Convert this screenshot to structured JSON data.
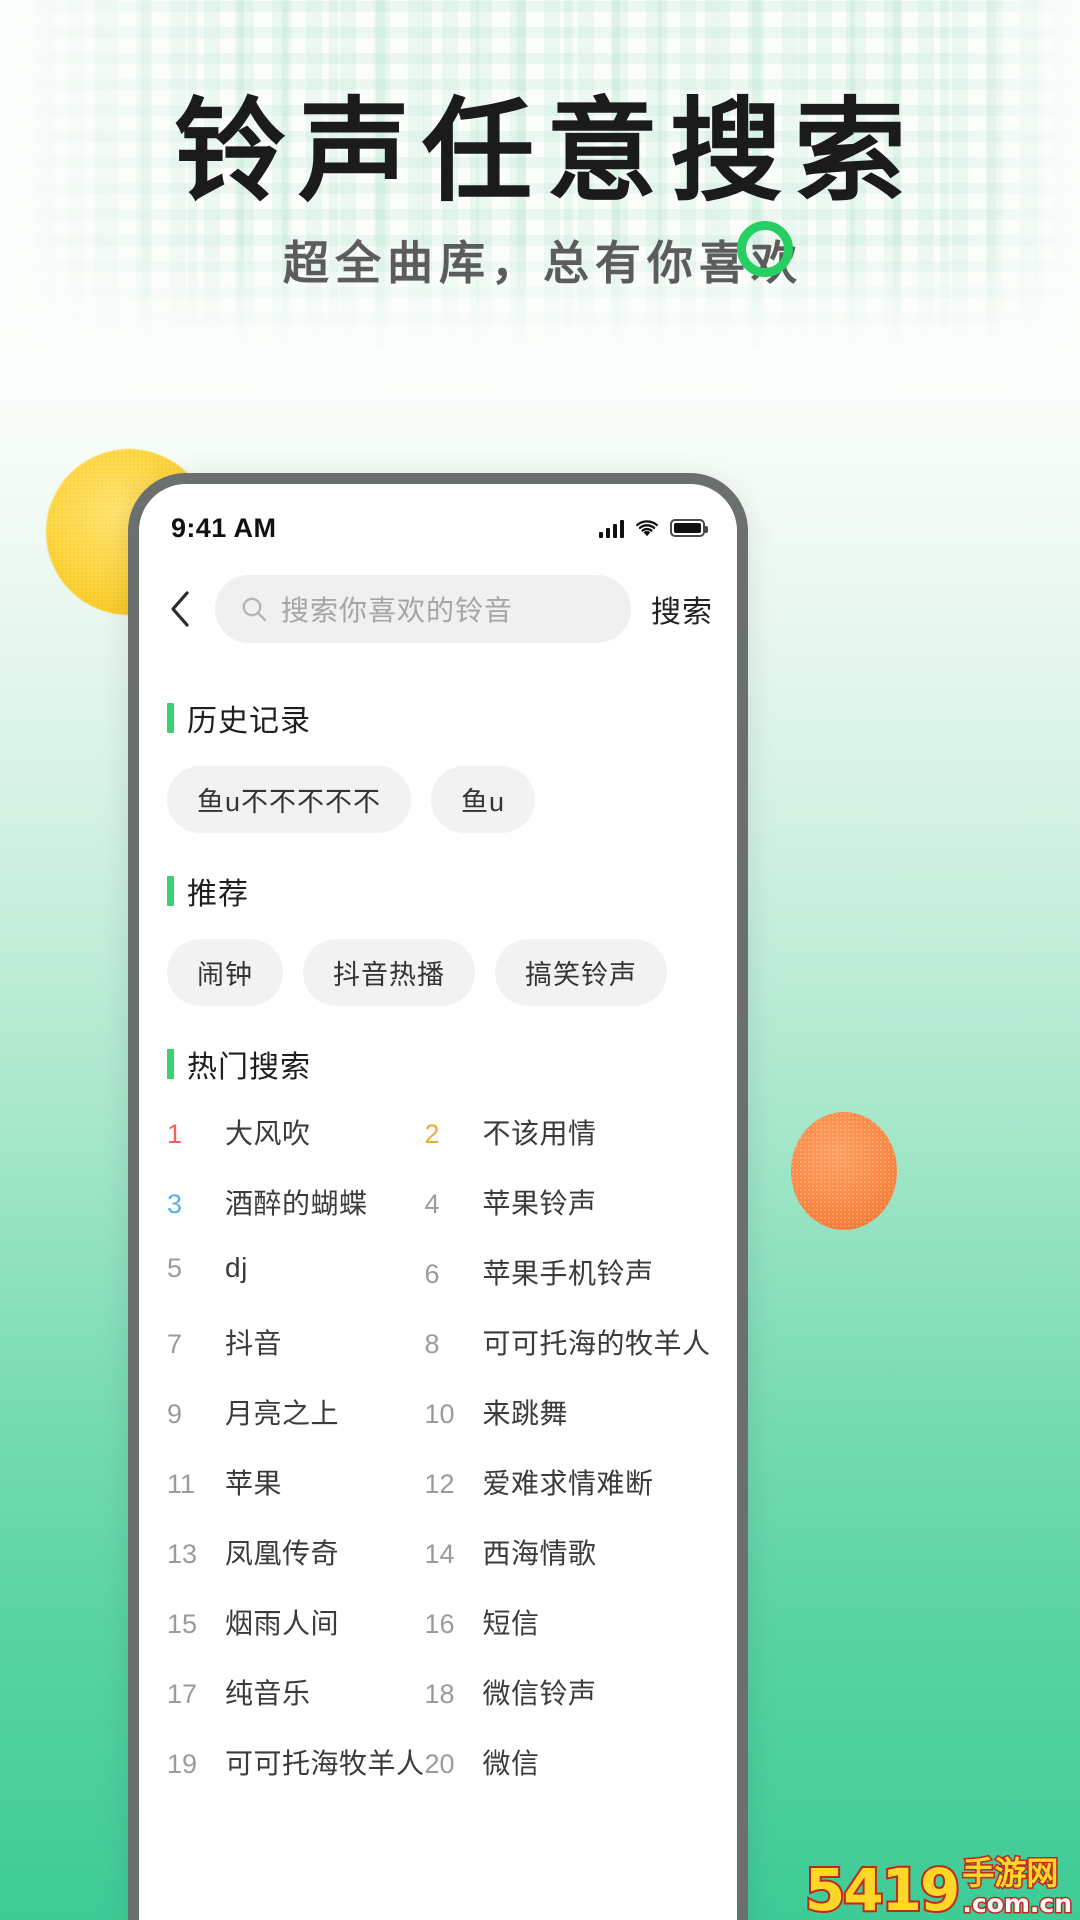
{
  "hero": {
    "title": "铃声任意搜索",
    "subtitle": "超全曲库，总有你喜欢",
    "ring_color": "#25cf62"
  },
  "phone": {
    "status_bar": {
      "time": "9:41 AM",
      "signal_icon": "signal-bars-icon",
      "wifi_icon": "wifi-icon",
      "battery_icon": "battery-full-icon"
    },
    "search": {
      "back_icon": "chevron-left-icon",
      "search_icon": "search-icon",
      "placeholder": "搜索你喜欢的铃音",
      "value": "",
      "action_label": "搜索"
    },
    "sections": [
      {
        "title": "历史记录",
        "type": "tags",
        "tags": [
          "鱼u不不不不不",
          "鱼u"
        ]
      },
      {
        "title": "推荐",
        "type": "tags",
        "tags": [
          "闹钟",
          "抖音热播",
          "搞笑铃声"
        ]
      },
      {
        "title": "热门搜索",
        "type": "ranked-list"
      }
    ],
    "hot_search": {
      "title": "热门搜索",
      "items": [
        {
          "rank": "1",
          "name": "大风吹"
        },
        {
          "rank": "2",
          "name": "不该用情"
        },
        {
          "rank": "3",
          "name": "酒醉的蝴蝶"
        },
        {
          "rank": "4",
          "name": "苹果铃声"
        },
        {
          "rank": "5",
          "name": "dj"
        },
        {
          "rank": "6",
          "name": "苹果手机铃声"
        },
        {
          "rank": "7",
          "name": "抖音"
        },
        {
          "rank": "8",
          "name": "可可托海的牧羊人"
        },
        {
          "rank": "9",
          "name": "月亮之上"
        },
        {
          "rank": "10",
          "name": "来跳舞"
        },
        {
          "rank": "11",
          "name": "苹果"
        },
        {
          "rank": "12",
          "name": "爱难求情难断"
        },
        {
          "rank": "13",
          "name": "凤凰传奇"
        },
        {
          "rank": "14",
          "name": "西海情歌"
        },
        {
          "rank": "15",
          "name": "烟雨人间"
        },
        {
          "rank": "16",
          "name": "短信"
        },
        {
          "rank": "17",
          "name": "纯音乐"
        },
        {
          "rank": "18",
          "name": "微信铃声"
        },
        {
          "rank": "19",
          "name": "可可托海牧羊人"
        },
        {
          "rank": "20",
          "name": "微信"
        }
      ],
      "rank_colors": {
        "1": "#f0635a",
        "2": "#eeab3a",
        "3": "#5aaff0",
        "default": "#9b9b9b"
      }
    }
  },
  "watermark": {
    "number": "5419",
    "cn": "手游网",
    "domain": ".com.cn"
  }
}
